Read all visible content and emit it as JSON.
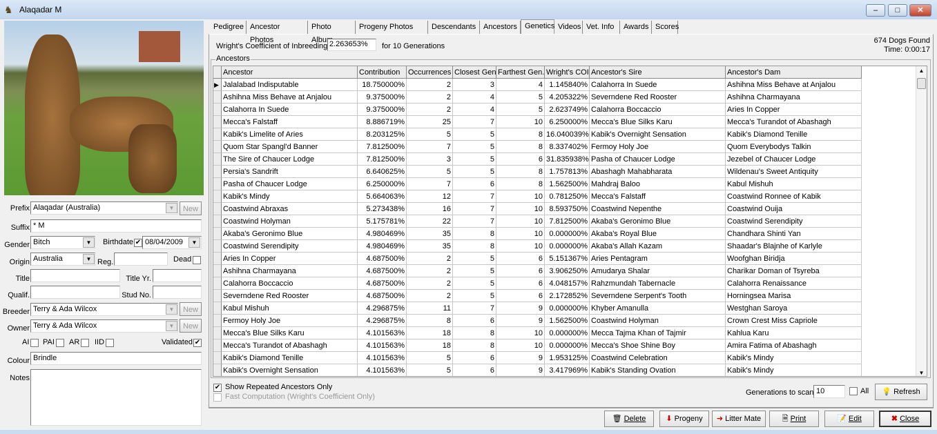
{
  "window": {
    "title": "Alaqadar M"
  },
  "form": {
    "prefix_label": "Prefix",
    "prefix": "Alaqadar (Australia)",
    "new_label": "New",
    "suffix_label": "Suffix",
    "suffix": "* M",
    "gender_label": "Gender",
    "gender": "Bitch",
    "birthdate_label": "Birthdate",
    "birthdate_checked": true,
    "birthdate": "08/04/2009",
    "origin_label": "Origin",
    "origin": "Australia",
    "reg_label": "Reg.",
    "reg": "",
    "dead_label": "Dead",
    "title_label": "Title",
    "title": "",
    "title_yr_label": "Title Yr.",
    "title_yr": "",
    "qualif_label": "Qualif.",
    "qualif": "",
    "stud_no_label": "Stud No.",
    "stud_no": "",
    "breeder_label": "Breeder",
    "breeder": "Terry & Ada Wilcox",
    "owner_label": "Owner",
    "owner": "Terry & Ada Wilcox",
    "ai_label": "AI",
    "pai_label": "PAI",
    "ar_label": "AR",
    "iid_label": "IID",
    "validated_label": "Validated",
    "validated": true,
    "colour_label": "Colour",
    "colour": "Brindle",
    "notes_label": "Notes",
    "notes": ""
  },
  "tabs": [
    "Pedigree",
    "Ancestor Photos",
    "Photo Album",
    "Progeny Photos",
    "Descendants",
    "Ancestors",
    "Genetics",
    "Videos",
    "Vet. Info",
    "Awards",
    "Scores"
  ],
  "active_tab": "Genetics",
  "genetics": {
    "coi_label": "Wright's Coefficient of Inbreeding:",
    "coi": "2.263653%",
    "generations_text": "for 10 Generations",
    "dogs_found": "674 Dogs Found",
    "time": "Time: 0:00:17",
    "group_label": "Ancestors",
    "columns": [
      "Ancestor",
      "Contribution",
      "Occurrences",
      "Closest Gen.",
      "Farthest Gen.",
      "Wright's COI",
      "Ancestor's Sire",
      "Ancestor's Dam"
    ],
    "rows": [
      [
        "Jalalabad Indisputable",
        "18.750000%",
        "2",
        "3",
        "4",
        "1.145840%",
        "Calahorra In Suede",
        "Ashihna Miss Behave at Anjalou"
      ],
      [
        "Ashihna Miss Behave at Anjalou",
        "9.375000%",
        "2",
        "4",
        "5",
        "4.205322%",
        "Severndene Red Rooster",
        "Ashihna Charmayana"
      ],
      [
        "Calahorra In Suede",
        "9.375000%",
        "2",
        "4",
        "5",
        "2.623749%",
        "Calahorra Boccaccio",
        "Aries In Copper"
      ],
      [
        "Mecca's Falstaff",
        "8.886719%",
        "25",
        "7",
        "10",
        "6.250000%",
        "Mecca's Blue Silks Karu",
        "Mecca's Turandot of Abashagh"
      ],
      [
        "Kabik's Limelite of Aries",
        "8.203125%",
        "5",
        "5",
        "8",
        "16.040039%",
        "Kabik's Overnight Sensation",
        "Kabik's Diamond Tenille"
      ],
      [
        "Quom Star Spangl'd Banner",
        "7.812500%",
        "7",
        "5",
        "8",
        "8.337402%",
        "Fermoy Holy Joe",
        "Quom Everybodys Talkin"
      ],
      [
        "The Sire of Chaucer Lodge",
        "7.812500%",
        "3",
        "5",
        "6",
        "31.835938%",
        "Pasha of Chaucer Lodge",
        "Jezebel of Chaucer Lodge"
      ],
      [
        "Persia's Sandrift",
        "6.640625%",
        "5",
        "5",
        "8",
        "1.757813%",
        "Abashagh Mahabharata",
        "Wildenau's Sweet Antiquity"
      ],
      [
        "Pasha of Chaucer Lodge",
        "6.250000%",
        "7",
        "6",
        "8",
        "1.562500%",
        "Mahdraj Baloo",
        "Kabul Mishuh"
      ],
      [
        "Kabik's Mindy",
        "5.664063%",
        "12",
        "7",
        "10",
        "0.781250%",
        "Mecca's Falstaff",
        "Coastwind Ronnee of Kabik"
      ],
      [
        "Coastwind Abraxas",
        "5.273438%",
        "16",
        "7",
        "10",
        "8.593750%",
        "Coastwind Nepenthe",
        "Coastwind Ouija"
      ],
      [
        "Coastwind Holyman",
        "5.175781%",
        "22",
        "7",
        "10",
        "7.812500%",
        "Akaba's Geronimo Blue",
        "Coastwind Serendipity"
      ],
      [
        "Akaba's Geronimo Blue",
        "4.980469%",
        "35",
        "8",
        "10",
        "0.000000%",
        "Akaba's Royal Blue",
        "Chandhara Shinti Yan"
      ],
      [
        "Coastwind Serendipity",
        "4.980469%",
        "35",
        "8",
        "10",
        "0.000000%",
        "Akaba's Allah Kazam",
        "Shaadar's Blajnhe of Karlyle"
      ],
      [
        "Aries In Copper",
        "4.687500%",
        "2",
        "5",
        "6",
        "5.151367%",
        "Aries Pentagram",
        "Woofghan Biridja"
      ],
      [
        "Ashihna Charmayana",
        "4.687500%",
        "2",
        "5",
        "6",
        "3.906250%",
        "Amudarya Shalar",
        "Charikar Doman of Tsyreba"
      ],
      [
        "Calahorra Boccaccio",
        "4.687500%",
        "2",
        "5",
        "6",
        "4.048157%",
        "Rahzmundah Tabernacle",
        "Calahorra Renaissance"
      ],
      [
        "Severndene Red Rooster",
        "4.687500%",
        "2",
        "5",
        "6",
        "2.172852%",
        "Severndene Serpent's Tooth",
        "Horningsea Marisa"
      ],
      [
        "Kabul Mishuh",
        "4.296875%",
        "11",
        "7",
        "9",
        "0.000000%",
        "Khyber Amanulla",
        "Westghan Saroya"
      ],
      [
        "Fermoy Holy Joe",
        "4.296875%",
        "8",
        "6",
        "9",
        "1.562500%",
        "Coastwind Holyman",
        "Crown Crest Miss Capriole"
      ],
      [
        "Mecca's Blue Silks Karu",
        "4.101563%",
        "18",
        "8",
        "10",
        "0.000000%",
        "Mecca Tajma Khan of Tajmir",
        "Kahlua Karu"
      ],
      [
        "Mecca's Turandot of Abashagh",
        "4.101563%",
        "18",
        "8",
        "10",
        "0.000000%",
        "Mecca's Shoe Shine Boy",
        "Amira Fatima of Abashagh"
      ],
      [
        "Kabik's Diamond Tenille",
        "4.101563%",
        "5",
        "6",
        "9",
        "1.953125%",
        "Coastwind Celebration",
        "Kabik's Mindy"
      ],
      [
        "Kabik's Overnight Sensation",
        "4.101563%",
        "5",
        "6",
        "9",
        "3.417969%",
        "Kabik's Standing Ovation",
        "Kabik's Mindy"
      ]
    ],
    "show_repeated_label": "Show Repeated Ancestors Only",
    "show_repeated": true,
    "fast_label": "Fast Computation (Wright's Coefficient Only)",
    "fast": false,
    "gens_scan_label": "Generations to scan",
    "gens_scan": "10",
    "all_label": "All",
    "refresh_label": "Refresh"
  },
  "buttons": {
    "delete": "Delete",
    "progeny": "Progeny",
    "litter_mate": "Litter Mate",
    "print": "Print",
    "edit": "Edit",
    "close": "Close"
  }
}
